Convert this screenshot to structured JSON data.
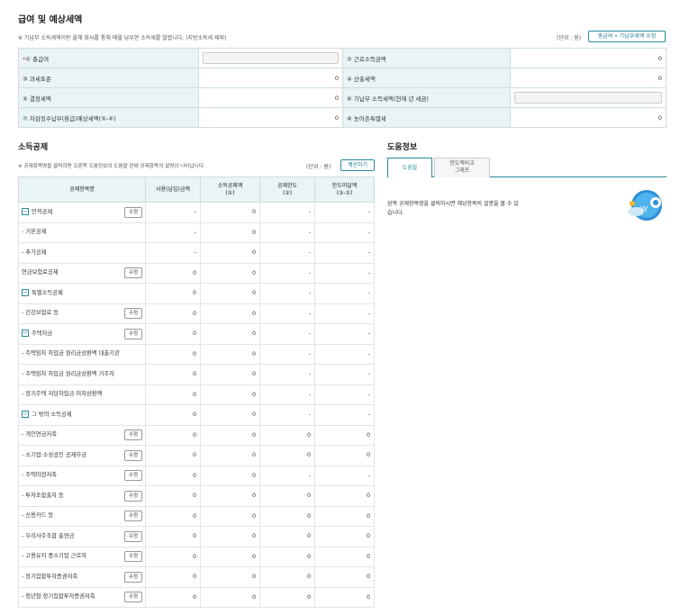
{
  "header": {
    "title": "급여 및 예상세액",
    "note": "※ 기납부 소득세액이란 올해 회사를 통해 매월 납부한 소득세를 말합니다. (지방소득세 제외)",
    "unit": "(단위 : 원)",
    "compare_button": "총급여 • 기납부세액 수정"
  },
  "salary_table": {
    "r1": {
      "l1": "① 총급여",
      "v1": "",
      "l2": "② 근로소득금액",
      "v2": "0"
    },
    "r2": {
      "l1": "③ 과세표준",
      "v1": "0",
      "l2": "④ 산출세액",
      "v2": "0"
    },
    "r3": {
      "l1": "⑤ 결정세액",
      "v1": "0",
      "l2": "⑥ 기납부 소득세액(현재 년 세금)",
      "v2": ""
    },
    "r4": {
      "l1": "⑦ 차감징수납부(환급)예상세액(⑤-⑥)",
      "v1": "0",
      "l2": "⑧ 농어촌특별세",
      "v2": "0"
    }
  },
  "deduction": {
    "title": "소득공제",
    "note": "※ 공제항목명을 클릭하면 오른쪽 도움정보의 도움말 란에 공제항목의 설명이 나타납니다.",
    "unit": "(단위 : 원)",
    "calc_button": "계산하기",
    "columns": [
      "공제항목명",
      "사용(납입)금액",
      "소득공제액\n(①)",
      "공제한도\n(②)",
      "한도미달액\n(②-①)"
    ],
    "edit_label": "수정",
    "rows": [
      {
        "name": "인적공제",
        "toggle": "−",
        "edit": true,
        "v": [
          "-",
          "0",
          "-",
          "-"
        ]
      },
      {
        "name": "- 기본공제",
        "edit": false,
        "v": [
          "-",
          "0",
          "-",
          "-"
        ]
      },
      {
        "name": "- 추가공제",
        "edit": false,
        "v": [
          "-",
          "0",
          "-",
          "-"
        ]
      },
      {
        "name": "연금보험료공제",
        "edit": true,
        "v": [
          "0",
          "0",
          "-",
          "-"
        ]
      },
      {
        "name": "특별소득공제",
        "toggle": "−",
        "edit": false,
        "v": [
          "0",
          "0",
          "-",
          "-"
        ]
      },
      {
        "name": "- 건강보험료 등",
        "edit": true,
        "v": [
          "0",
          "0",
          "-",
          "-"
        ]
      },
      {
        "name": "주택자금",
        "toggle": "−",
        "edit": true,
        "v": [
          "0",
          "0",
          "-",
          "-"
        ]
      },
      {
        "name": "- 주택임차 차입금 원리금상환액 대출기관",
        "edit": false,
        "v": [
          "0",
          "0",
          "-",
          "-"
        ]
      },
      {
        "name": "- 주택임차 차입금 원리금상환액 거주자",
        "edit": false,
        "v": [
          "0",
          "0",
          "-",
          "-"
        ]
      },
      {
        "name": "- 장기주택 저당차입금 이자상환액",
        "edit": false,
        "v": [
          "0",
          "0",
          "-",
          "-"
        ]
      },
      {
        "name": "그 밖의 소득공제",
        "toggle": "−",
        "edit": false,
        "v": [
          "0",
          "0",
          "-",
          "-"
        ]
      },
      {
        "name": "- 개인연금저축",
        "edit": true,
        "v": [
          "0",
          "0",
          "0",
          "0"
        ]
      },
      {
        "name": "- 소기업·소상공인 공제부금",
        "edit": true,
        "v": [
          "0",
          "0",
          "0",
          "0"
        ]
      },
      {
        "name": "- 주택마련저축",
        "edit": true,
        "v": [
          "0",
          "0",
          "-",
          "-"
        ]
      },
      {
        "name": "- 투자조합출자 등",
        "edit": true,
        "v": [
          "0",
          "0",
          "0",
          "0"
        ]
      },
      {
        "name": "- 신용카드 등",
        "edit": true,
        "v": [
          "0",
          "0",
          "0",
          "0"
        ]
      },
      {
        "name": "- 우리사주조합 출연금",
        "edit": true,
        "v": [
          "0",
          "0",
          "0",
          "0"
        ]
      },
      {
        "name": "- 고용유지 중소기업 근로자",
        "edit": true,
        "v": [
          "0",
          "0",
          "0",
          "0"
        ]
      },
      {
        "name": "- 장기집합투자증권저축",
        "edit": true,
        "v": [
          "0",
          "0",
          "0",
          "0"
        ]
      },
      {
        "name": "- 청년형 장기집합투자증권저축",
        "edit": true,
        "v": [
          "0",
          "0",
          "0",
          "0"
        ]
      }
    ]
  },
  "help": {
    "title": "도움정보",
    "tab_active": "도움말",
    "tab_inactive": "한도액비교\n그래프",
    "text": "왼쪽 공제항목명을 클릭하시면 해당항목의 설명을 볼 수 있습니다."
  },
  "colors": {
    "accent": "#2a8a9c",
    "header_bg": "#eaf3f5"
  },
  "icons": [
    "minus-toggle-icon",
    "mascot-icon"
  ]
}
